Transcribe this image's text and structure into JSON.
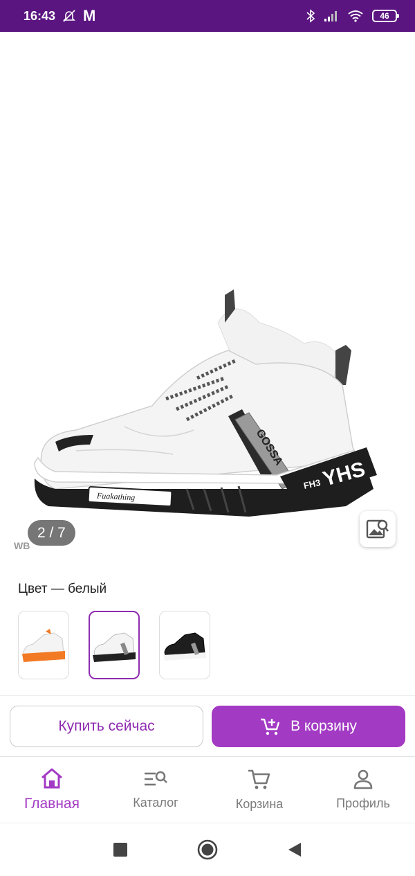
{
  "status_bar": {
    "time": "16:43",
    "app_letter": "M",
    "battery": "46",
    "icons": [
      "bell-off-icon",
      "bluetooth-icon",
      "signal-icon",
      "wifi-icon",
      "battery-icon"
    ]
  },
  "gallery": {
    "counter": "2 / 7",
    "watermark": "WB",
    "current_index": 2,
    "total": 7,
    "side_text": "YHS",
    "strap_text": "GOSSA",
    "sole_badge": "Fuakathing",
    "side_logo": "FH3"
  },
  "color": {
    "label": "Цвет — белый",
    "options": [
      {
        "name": "orange",
        "selected": false
      },
      {
        "name": "white",
        "selected": true
      },
      {
        "name": "black",
        "selected": false
      }
    ]
  },
  "actions": {
    "buy_now": "Купить сейчас",
    "add_to_cart": "В корзину"
  },
  "nav": {
    "items": [
      {
        "label": "Главная",
        "icon": "home-icon",
        "active": true
      },
      {
        "label": "Каталог",
        "icon": "catalog-icon",
        "active": false
      },
      {
        "label": "Корзина",
        "icon": "cart-icon",
        "active": false
      },
      {
        "label": "Профиль",
        "icon": "profile-icon",
        "active": false
      }
    ]
  },
  "colors": {
    "status_bar": "#5b1580",
    "accent": "#a33ac4",
    "accent_text": "#8e2cb0"
  }
}
